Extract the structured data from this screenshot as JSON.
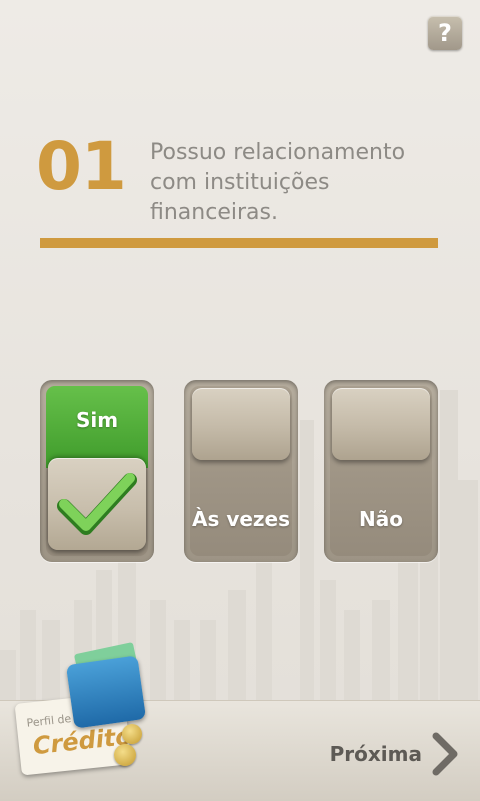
{
  "help": {
    "label": "?"
  },
  "question": {
    "number": "01",
    "lines": [
      "Possuo relacionamento",
      "com instituições",
      "financeiras."
    ]
  },
  "options": [
    {
      "label": "Sim",
      "selected": true
    },
    {
      "label": "Às vezes",
      "selected": false
    },
    {
      "label": "Não",
      "selected": false
    }
  ],
  "footer": {
    "next_label": "Próxima"
  },
  "logo": {
    "small_text": "Perfil de",
    "big_text": "Crédito"
  },
  "colors": {
    "accent": "#cf9a3f",
    "selected": "#4caf3a",
    "text_muted": "#8d8a85"
  },
  "icons": {
    "help": "question-mark-icon",
    "check": "check-icon",
    "next": "chevron-right-icon"
  }
}
